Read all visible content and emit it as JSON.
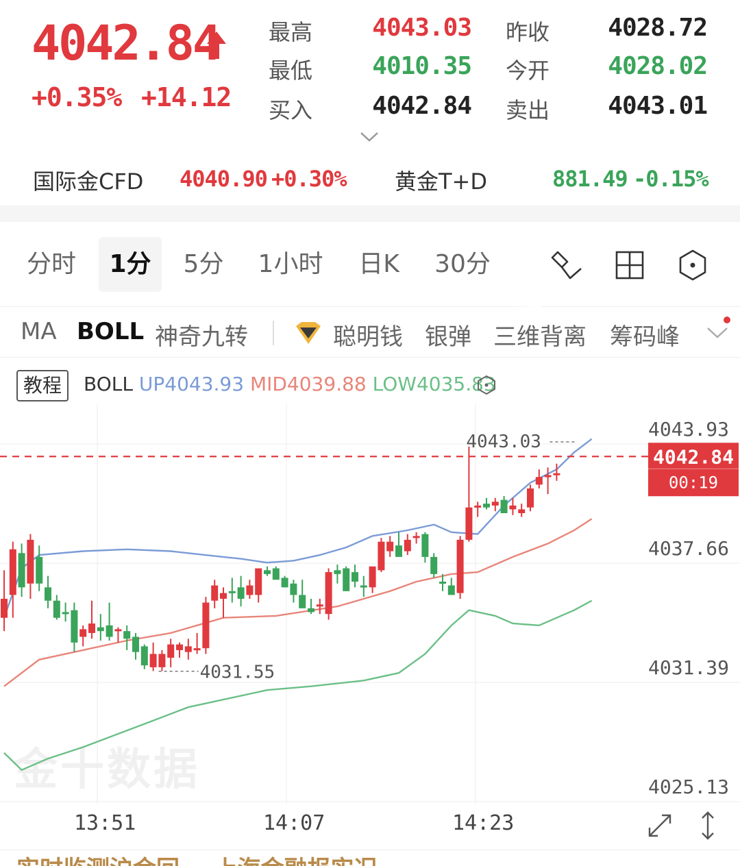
{
  "quote": {
    "price": "4042.84",
    "change_pct": "+0.35%",
    "change_abs": "+14.12",
    "stats": [
      {
        "label": "最高",
        "value": "4043.03",
        "color": "#e0393e"
      },
      {
        "label": "昨收",
        "value": "4028.72",
        "color": "#222222"
      },
      {
        "label": "最低",
        "value": "4010.35",
        "color": "#3aa45a"
      },
      {
        "label": "今开",
        "value": "4028.02",
        "color": "#3aa45a"
      },
      {
        "label": "买入",
        "value": "4042.84",
        "color": "#222222"
      },
      {
        "label": "卖出",
        "value": "4043.01",
        "color": "#222222"
      }
    ]
  },
  "related": [
    {
      "name": "国际金CFD",
      "price": "4040.90",
      "change": "+0.30%",
      "color": "#e0393e"
    },
    {
      "name": "黄金T+D",
      "price": "881.49",
      "change": "-0.15%",
      "color": "#3aa45a"
    }
  ],
  "timeframes": [
    "分时",
    "1分",
    "5分",
    "1小时",
    "日K",
    "30分"
  ],
  "active_timeframe": "1分",
  "indicators": [
    "MA",
    "BOLL",
    "神奇九转",
    "聪明钱",
    "银弹",
    "三维背离",
    "筹码峰"
  ],
  "active_indicator": "BOLL",
  "legend": {
    "tutorial": "教程",
    "name": "BOLL",
    "up": "UP4043.93",
    "mid": "MID4039.88",
    "low": "LOW4035.83"
  },
  "colors": {
    "up": "#e0393e",
    "down": "#3aa45a",
    "boll_up": "#7b9bd6",
    "boll_mid": "#e8857a",
    "boll_low": "#6bbf87"
  },
  "watermark": "金十数据",
  "news_snippet": "实时监测沪金回... 上海金融报实况",
  "chart_data": {
    "type": "candlestick",
    "y_ticks": [
      "4043.93",
      "4037.66",
      "4031.39",
      "4025.13"
    ],
    "ylim": [
      4025.13,
      4043.93
    ],
    "x_labels": [
      "13:51",
      "14:07",
      "14:23"
    ],
    "current_price": "4042.84",
    "countdown": "00:19",
    "high_label": "4043.03",
    "low_label": "4031.55",
    "candles": [
      {
        "o": 4034.0,
        "h": 4036.5,
        "l": 4033.3,
        "c": 4035.0
      },
      {
        "o": 4035.2,
        "h": 4038.0,
        "l": 4034.0,
        "c": 4037.6
      },
      {
        "o": 4037.4,
        "h": 4037.9,
        "l": 4035.1,
        "c": 4035.6
      },
      {
        "o": 4035.8,
        "h": 4038.4,
        "l": 4035.0,
        "c": 4038.1
      },
      {
        "o": 4037.2,
        "h": 4037.8,
        "l": 4035.4,
        "c": 4035.8
      },
      {
        "o": 4035.6,
        "h": 4036.2,
        "l": 4034.5,
        "c": 4034.9
      },
      {
        "o": 4034.9,
        "h": 4035.2,
        "l": 4033.9,
        "c": 4034.0
      },
      {
        "o": 4034.3,
        "h": 4034.8,
        "l": 4033.8,
        "c": 4034.2
      },
      {
        "o": 4034.4,
        "h": 4034.8,
        "l": 4032.2,
        "c": 4032.7
      },
      {
        "o": 4033.0,
        "h": 4033.6,
        "l": 4032.5,
        "c": 4033.4
      },
      {
        "o": 4033.2,
        "h": 4034.9,
        "l": 4032.9,
        "c": 4033.7
      },
      {
        "o": 4033.5,
        "h": 4034.2,
        "l": 4032.8,
        "c": 4033.3
      },
      {
        "o": 4033.6,
        "h": 4034.8,
        "l": 4032.8,
        "c": 4033.0
      },
      {
        "o": 4033.3,
        "h": 4033.5,
        "l": 4032.7,
        "c": 4033.4
      },
      {
        "o": 4033.3,
        "h": 4033.6,
        "l": 4032.3,
        "c": 4032.9
      },
      {
        "o": 4033.0,
        "h": 4033.2,
        "l": 4031.8,
        "c": 4032.2
      },
      {
        "o": 4032.5,
        "h": 4032.6,
        "l": 4031.3,
        "c": 4031.5
      },
      {
        "o": 4031.4,
        "h": 4032.7,
        "l": 4031.2,
        "c": 4032.1
      },
      {
        "o": 4031.4,
        "h": 4032.3,
        "l": 4031.2,
        "c": 4032.1
      },
      {
        "o": 4031.9,
        "h": 4032.9,
        "l": 4031.4,
        "c": 4032.6
      },
      {
        "o": 4032.3,
        "h": 4032.7,
        "l": 4031.9,
        "c": 4032.6
      },
      {
        "o": 4032.2,
        "h": 4032.9,
        "l": 4031.8,
        "c": 4032.5
      },
      {
        "o": 4032.3,
        "h": 4033.2,
        "l": 4032.1,
        "c": 4032.4
      },
      {
        "o": 4032.4,
        "h": 4035.1,
        "l": 4032.1,
        "c": 4034.8
      },
      {
        "o": 4034.9,
        "h": 4036.0,
        "l": 4034.5,
        "c": 4035.7
      },
      {
        "o": 4035.0,
        "h": 4035.6,
        "l": 4034.0,
        "c": 4035.3
      },
      {
        "o": 4035.4,
        "h": 4036.1,
        "l": 4034.8,
        "c": 4035.3
      },
      {
        "o": 4035.6,
        "h": 4036.2,
        "l": 4034.6,
        "c": 4035.0
      },
      {
        "o": 4035.2,
        "h": 4036.0,
        "l": 4035.0,
        "c": 4035.7
      },
      {
        "o": 4035.2,
        "h": 4036.2,
        "l": 4034.8,
        "c": 4036.6
      },
      {
        "o": 4036.5,
        "h": 4036.7,
        "l": 4036.2,
        "c": 4036.3
      },
      {
        "o": 4036.6,
        "h": 4036.7,
        "l": 4036.1,
        "c": 4036.0
      },
      {
        "o": 4036.1,
        "h": 4036.2,
        "l": 4035.6,
        "c": 4035.6
      },
      {
        "o": 4035.8,
        "h": 4036.0,
        "l": 4034.8,
        "c": 4035.2
      },
      {
        "o": 4035.2,
        "h": 4036.0,
        "l": 4034.8,
        "c": 4034.5
      },
      {
        "o": 4034.5,
        "h": 4035.0,
        "l": 4034.2,
        "c": 4034.3
      },
      {
        "o": 4034.6,
        "h": 4035.0,
        "l": 4034.2,
        "c": 4034.7
      },
      {
        "o": 4034.2,
        "h": 4036.6,
        "l": 4033.9,
        "c": 4036.4
      },
      {
        "o": 4036.5,
        "h": 4036.8,
        "l": 4035.8,
        "c": 4036.3
      },
      {
        "o": 4036.6,
        "h": 4036.7,
        "l": 4035.5,
        "c": 4035.4
      },
      {
        "o": 4036.4,
        "h": 4036.8,
        "l": 4035.6,
        "c": 4035.9
      },
      {
        "o": 4035.7,
        "h": 4036.2,
        "l": 4035.1,
        "c": 4035.6
      },
      {
        "o": 4035.6,
        "h": 4036.6,
        "l": 4035.3,
        "c": 4036.7
      },
      {
        "o": 4036.5,
        "h": 4038.2,
        "l": 4036.4,
        "c": 4038.0
      },
      {
        "o": 4037.5,
        "h": 4038.3,
        "l": 4037.2,
        "c": 4038.0
      },
      {
        "o": 4037.8,
        "h": 4038.5,
        "l": 4037.5,
        "c": 4037.2
      },
      {
        "o": 4037.5,
        "h": 4038.4,
        "l": 4037.3,
        "c": 4038.1
      },
      {
        "o": 4038.2,
        "h": 4038.5,
        "l": 4037.9,
        "c": 4038.3
      },
      {
        "o": 4038.4,
        "h": 4038.5,
        "l": 4036.9,
        "c": 4037.2
      },
      {
        "o": 4037.2,
        "h": 4037.4,
        "l": 4036.1,
        "c": 4036.3
      },
      {
        "o": 4035.9,
        "h": 4036.3,
        "l": 4035.4,
        "c": 4035.8
      },
      {
        "o": 4035.7,
        "h": 4036.1,
        "l": 4035.3,
        "c": 4035.2
      },
      {
        "o": 4035.3,
        "h": 4038.3,
        "l": 4035.0,
        "c": 4038.1
      },
      {
        "o": 4038.1,
        "h": 4043.0,
        "l": 4038.0,
        "c": 4039.8
      },
      {
        "o": 4039.8,
        "h": 4040.1,
        "l": 4039.3,
        "c": 4039.9
      },
      {
        "o": 4040.0,
        "h": 4040.3,
        "l": 4039.7,
        "c": 4039.8
      },
      {
        "o": 4039.9,
        "h": 4040.3,
        "l": 4039.6,
        "c": 4040.1
      },
      {
        "o": 4040.2,
        "h": 4040.4,
        "l": 4039.5,
        "c": 4039.5
      },
      {
        "o": 4039.7,
        "h": 4040.3,
        "l": 4039.4,
        "c": 4039.9
      },
      {
        "o": 4039.5,
        "h": 4040.0,
        "l": 4039.3,
        "c": 4039.7
      },
      {
        "o": 4039.8,
        "h": 4041.0,
        "l": 4039.6,
        "c": 4040.8
      },
      {
        "o": 4041.0,
        "h": 4041.8,
        "l": 4040.8,
        "c": 4041.4
      },
      {
        "o": 4041.5,
        "h": 4041.9,
        "l": 4040.5,
        "c": 4041.5
      },
      {
        "o": 4041.6,
        "h": 4042.1,
        "l": 4041.2,
        "c": 4041.6
      }
    ],
    "boll_up": [
      [
        0,
        4034.0
      ],
      [
        2,
        4036.6
      ],
      [
        4,
        4037.3
      ],
      [
        9,
        4037.5
      ],
      [
        14,
        4037.6
      ],
      [
        19,
        4037.5
      ],
      [
        25,
        4037.2
      ],
      [
        27,
        4037.1
      ],
      [
        30,
        4036.9
      ],
      [
        33,
        4037.0
      ],
      [
        36,
        4037.3
      ],
      [
        39,
        4037.7
      ],
      [
        42,
        4038.3
      ],
      [
        46,
        4038.6
      ],
      [
        49,
        4038.9
      ],
      [
        51,
        4038.5
      ],
      [
        54,
        4038.4
      ],
      [
        57,
        4039.9
      ],
      [
        60,
        4041.1
      ],
      [
        63,
        4041.8
      ],
      [
        65,
        4042.7
      ],
      [
        67,
        4043.4
      ]
    ],
    "boll_mid": [
      [
        0,
        4030.4
      ],
      [
        4,
        4031.8
      ],
      [
        9,
        4032.3
      ],
      [
        14,
        4032.8
      ],
      [
        19,
        4033.2
      ],
      [
        25,
        4034.0
      ],
      [
        31,
        4034.1
      ],
      [
        38,
        4034.6
      ],
      [
        44,
        4035.4
      ],
      [
        47,
        4035.9
      ],
      [
        51,
        4036.3
      ],
      [
        54,
        4036.4
      ],
      [
        58,
        4037.2
      ],
      [
        62,
        4037.9
      ],
      [
        65,
        4038.6
      ],
      [
        67,
        4039.2
      ]
    ],
    "boll_low": [
      [
        0,
        4026.9
      ],
      [
        2,
        4026.0
      ],
      [
        5,
        4026.6
      ],
      [
        9,
        4027.2
      ],
      [
        13,
        4027.9
      ],
      [
        17,
        4028.6
      ],
      [
        21,
        4029.3
      ],
      [
        25,
        4029.7
      ],
      [
        30,
        4030.2
      ],
      [
        35,
        4030.4
      ],
      [
        41,
        4030.7
      ],
      [
        45,
        4031.1
      ],
      [
        48,
        4032.1
      ],
      [
        51,
        4033.6
      ],
      [
        53,
        4034.4
      ],
      [
        56,
        4034.1
      ],
      [
        58,
        4033.7
      ],
      [
        61,
        4033.6
      ],
      [
        63,
        4034.0
      ],
      [
        65,
        4034.4
      ],
      [
        67,
        4034.9
      ]
    ]
  }
}
